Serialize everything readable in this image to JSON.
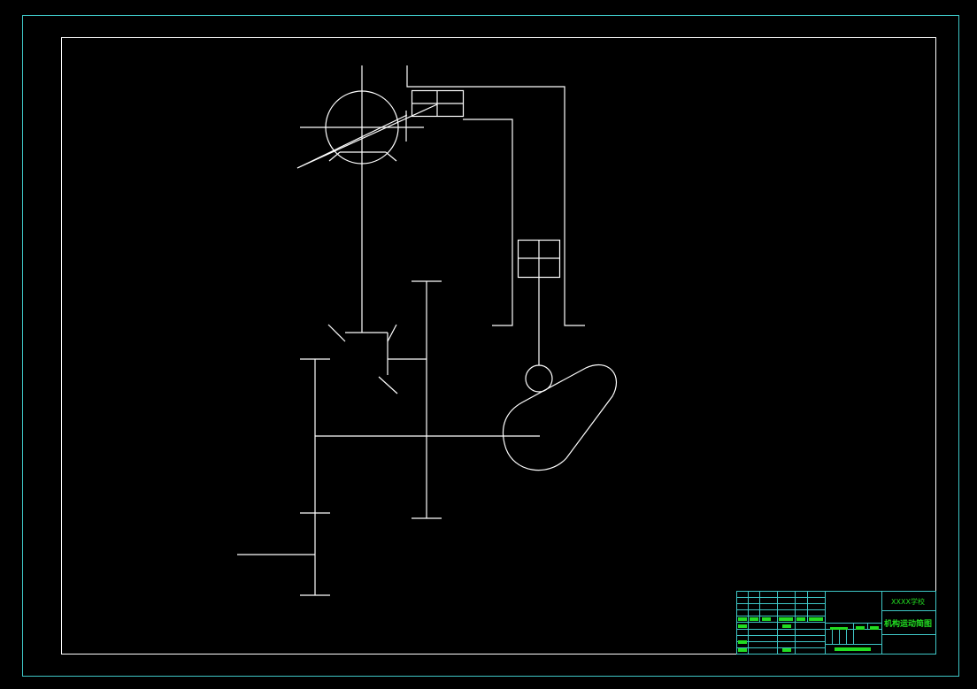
{
  "colors": {
    "background": "#000000",
    "sheet_border": "#3fc7c7",
    "frame": "#ffffff",
    "mechanism_line": "#ffffff",
    "title_block_grid": "#3fc7c7",
    "title_block_fill": "#22dd22",
    "title_block_text": "#22dd22"
  },
  "title_block": {
    "school": "XXXX学校",
    "drawing_title": "机构运动简图"
  }
}
